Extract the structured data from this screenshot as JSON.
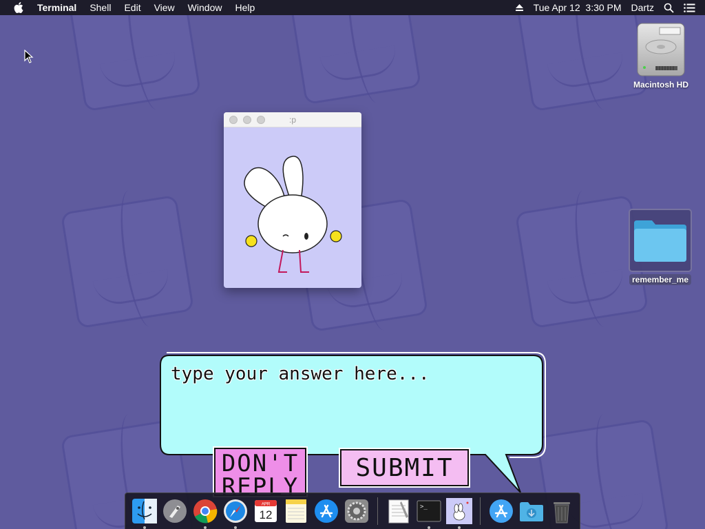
{
  "menubar": {
    "apple_icon": "apple-logo-icon",
    "app_name": "Terminal",
    "items": [
      "Shell",
      "Edit",
      "View",
      "Window",
      "Help"
    ],
    "clock": "Tue Apr 12  3:30 PM",
    "user": "Dartz",
    "eject_icon": "eject-icon",
    "search_icon": "spotlight-search-icon",
    "list_icon": "notification-list-icon"
  },
  "desktop": {
    "hd_label": "Macintosh HD",
    "folder_label": "remember_me"
  },
  "mini_window": {
    "title": ":p",
    "image_icon": "bunny-character-icon"
  },
  "dialog": {
    "placeholder": "type your answer here...",
    "dont_reply_label": "DON'T\nREPLY",
    "submit_label": "SUBMIT",
    "bubble_color": "#b2fcfb",
    "button_color": "#f4bdf2"
  },
  "dock": {
    "apps": [
      {
        "name": "finder-icon",
        "running": true
      },
      {
        "name": "launchpad-icon",
        "running": false
      },
      {
        "name": "chrome-icon",
        "running": true
      },
      {
        "name": "safari-icon",
        "running": true
      },
      {
        "name": "calendar-icon",
        "running": false
      },
      {
        "name": "notes-icon",
        "running": false
      },
      {
        "name": "app-store-icon",
        "running": false
      },
      {
        "name": "system-preferences-icon",
        "running": false
      },
      {
        "name": "textedit-icon",
        "running": false
      },
      {
        "name": "terminal-icon",
        "running": true
      },
      {
        "name": "bunny-app-icon",
        "running": true
      },
      {
        "name": "app-store-downloads-icon",
        "running": false
      },
      {
        "name": "downloads-folder-icon",
        "running": false
      },
      {
        "name": "trash-icon",
        "running": false
      }
    ],
    "calendar_month": "APR",
    "calendar_day": "12"
  },
  "colors": {
    "desktop_bg": "#5f5b9e",
    "menubar_bg": "#1d1c2a",
    "window_bg": "#cccbf8"
  }
}
